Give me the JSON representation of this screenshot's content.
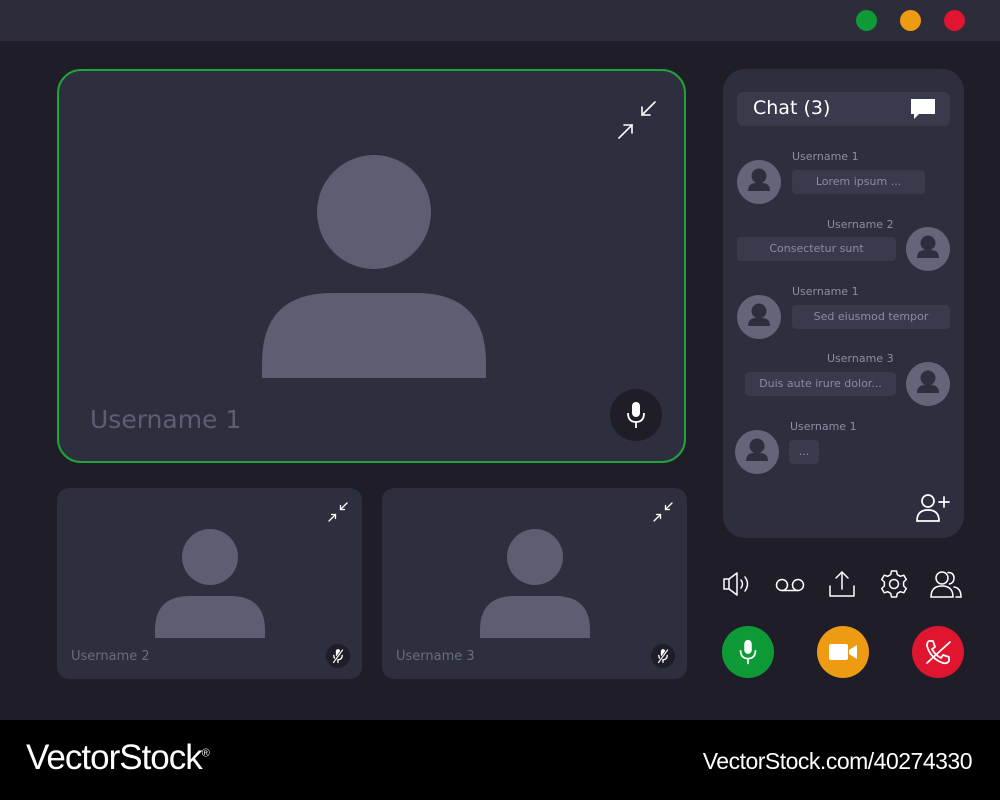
{
  "window": {
    "controls": [
      {
        "name": "maximize",
        "color": "#0d9a37"
      },
      {
        "name": "minimize",
        "color": "#ee9b14"
      },
      {
        "name": "close",
        "color": "#e0152f"
      }
    ]
  },
  "colors": {
    "background": "#1f1d28",
    "tile": "#2d2f3e",
    "active_border": "#21a33c",
    "avatar": "#5e5e72",
    "mic_green": "#0d9a37",
    "camera_orange": "#ee9b14",
    "hangup_red": "#e0152f"
  },
  "video": {
    "main": {
      "username": "Username 1",
      "collapse_icon": "collapse-arrows-icon",
      "mic_icon": "microphone-icon"
    },
    "participants": [
      {
        "username": "Username 2",
        "collapse_icon": "collapse-arrows-icon",
        "mic_icon": "microphone-muted-icon"
      },
      {
        "username": "Username 3",
        "collapse_icon": "collapse-arrows-icon",
        "mic_icon": "microphone-muted-icon"
      }
    ]
  },
  "chat": {
    "title": "Chat (3)",
    "header_icon": "chat-bubble-icon",
    "messages": [
      {
        "username": "Username 1",
        "text": "Lorem ipsum ..."
      },
      {
        "username": "Username 2",
        "text": "Consectetur sunt"
      },
      {
        "username": "Username 1",
        "text": "Sed eiusmod tempor"
      },
      {
        "username": "Username 3",
        "text": "Duis aute irure dolor..."
      },
      {
        "username": "Username 1",
        "text": "..."
      }
    ],
    "add_user_icon": "add-user-icon"
  },
  "toolbar": [
    "speaker-icon",
    "voicemail-icon",
    "share-upload-icon",
    "settings-gear-icon",
    "participants-icon"
  ],
  "call_controls": [
    {
      "name": "microphone",
      "icon": "microphone-icon",
      "color": "#0d9a37"
    },
    {
      "name": "camera",
      "icon": "video-camera-icon",
      "color": "#ee9b14"
    },
    {
      "name": "end-call",
      "icon": "hang-up-icon",
      "color": "#e0152f"
    }
  ],
  "footer": {
    "brand": "VectorStock",
    "brand_registered": "®",
    "url": "VectorStock.com/40274330"
  }
}
